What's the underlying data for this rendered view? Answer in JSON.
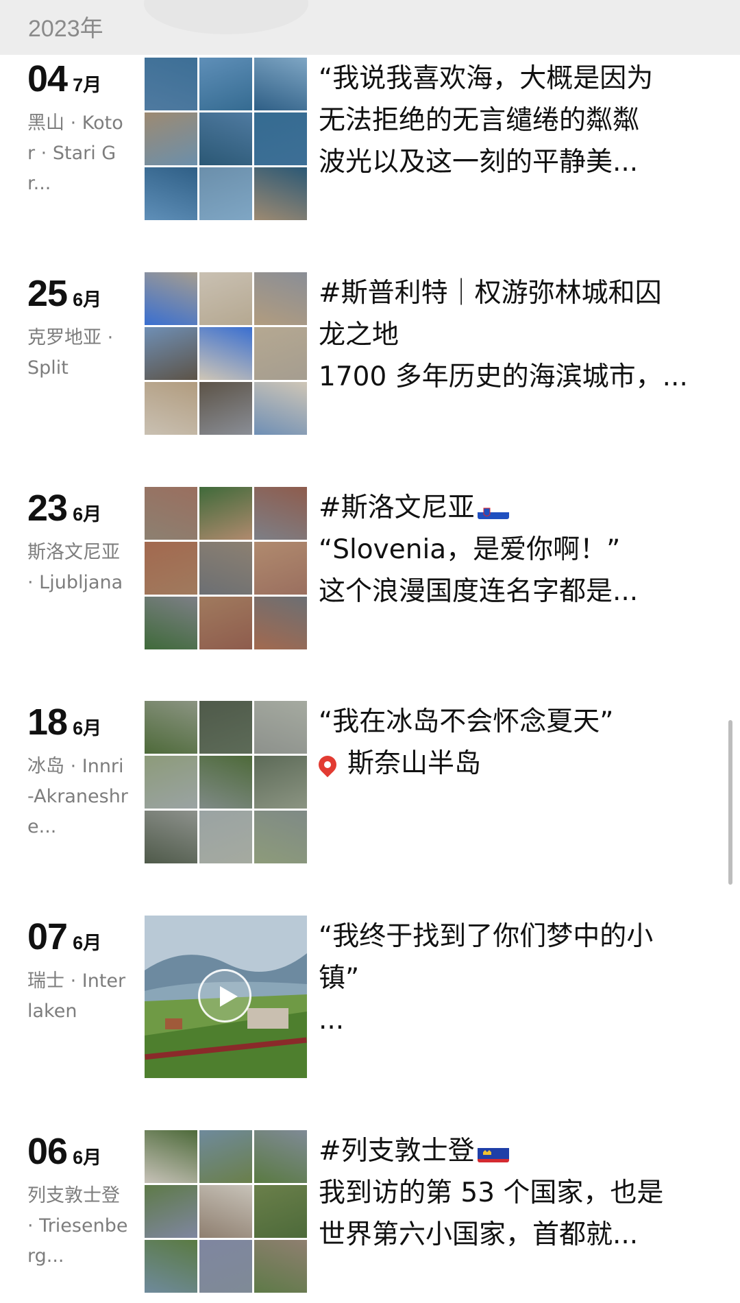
{
  "header": {
    "year": "2023年"
  },
  "entries": [
    {
      "day": "04",
      "month": "7月",
      "location": "黑山 · Kotor · Stari Gr...",
      "media": "grid",
      "text_lines": [
        "“我说我喜欢海，大概是因为",
        "无法拒绝的无言缱绻的粼粼",
        "波光以及这一刻的平静美..."
      ]
    },
    {
      "day": "25",
      "month": "6月",
      "location": "克罗地亚 · Split",
      "media": "grid",
      "text_lines": [
        "#斯普利特｜权游弥林城和囚",
        "龙之地",
        "1700 多年历史的海滨城市，..."
      ]
    },
    {
      "day": "23",
      "month": "6月",
      "location": "斯洛文尼亚 · Ljubljana",
      "media": "grid",
      "text_lines": [
        "#斯洛文尼亚",
        "“Slovenia，是爱你啊！”",
        "这个浪漫国度连名字都是..."
      ]
    },
    {
      "day": "18",
      "month": "6月",
      "location": "冰岛 · Innri-Akraneshre...",
      "media": "grid",
      "text_lines": [
        "“我在冰岛不会怀念夏天”",
        "",
        "斯奈山半岛"
      ]
    },
    {
      "day": "07",
      "month": "6月",
      "location": "瑞士 · Interlaken",
      "media": "video",
      "text_lines": [
        "“我终于找到了你们梦中的小",
        "镇”",
        "..."
      ]
    },
    {
      "day": "06",
      "month": "6月",
      "location": "列支敦士登 · Triesenberg...",
      "media": "grid",
      "text_lines": [
        "#列支敦士登",
        "我到访的第 53 个国家，也是",
        "世界第六小国家，首都就..."
      ]
    }
  ],
  "icons": {
    "flag_slovenia": "flag-slovenia-icon",
    "flag_liechtenstein": "flag-liechtenstein-icon",
    "pin": "map-pin-icon",
    "play": "play-icon"
  },
  "palettes": [
    [
      "#3d6f96",
      "#5f8fb8",
      "#7fa6c4",
      "#9d8a72",
      "#4f7aa0",
      "#356b91",
      "#2f5f86",
      "#6b8fab",
      "#2b5875"
    ],
    [
      "#a59d90",
      "#c9c0b2",
      "#8a8e96",
      "#6f8fb5",
      "#3a6fd0",
      "#b5a891",
      "#b19c7f",
      "#5c5347",
      "#cfc6b6"
    ],
    [
      "#9a6f5f",
      "#3f6a3a",
      "#8e5c4d",
      "#a2694f",
      "#8c8071",
      "#b08a6e",
      "#7d7f86",
      "#a07a5e",
      "#6c6f73"
    ],
    [
      "#8b9482",
      "#4f5a4a",
      "#a5aaa0",
      "#8d9b7a",
      "#4e6a3a",
      "#5d6b58",
      "#8d918c",
      "#9aa3a3",
      "#7f8a86"
    ],
    [
      "#6e8fa8",
      "#5e8a4a"
    ],
    [
      "#4d6a3a",
      "#6f8a9c",
      "#7f8a96",
      "#5e7a48",
      "#c7c2b8",
      "#6a7f4a",
      "#5a7a42",
      "#7f86a0",
      "#8f7f70"
    ]
  ]
}
